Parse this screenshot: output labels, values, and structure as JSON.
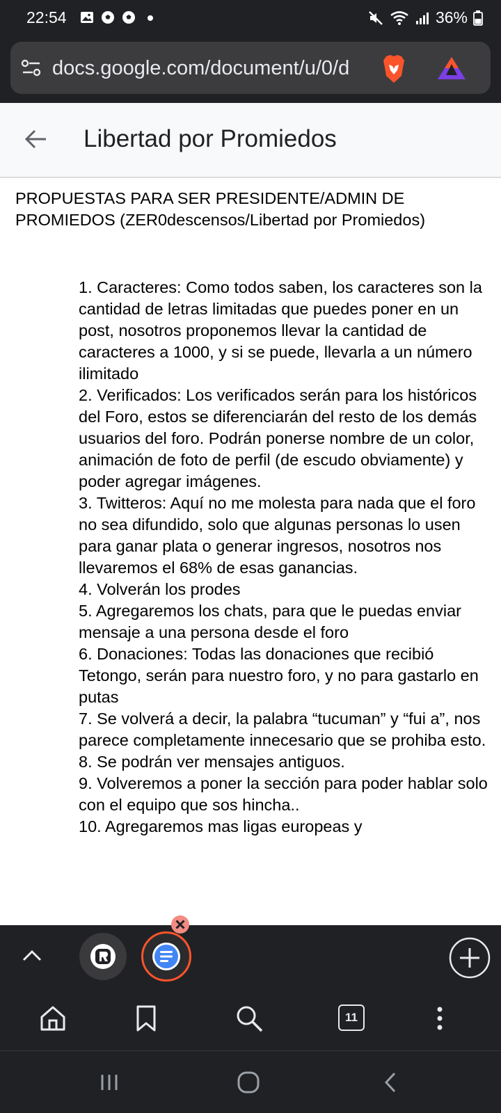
{
  "status_bar": {
    "time": "22:54",
    "battery": "36%",
    "left_icons": [
      "gallery-icon",
      "soccer-ball-icon",
      "soccer-ball-icon",
      "dot-icon"
    ],
    "right_icons": [
      "mute-icon",
      "wifi-icon",
      "signal-icon",
      "battery-icon"
    ]
  },
  "browser": {
    "url": "docs.google.com/document/u/0/d",
    "icons": [
      "site-settings-icon",
      "brave-shields-icon",
      "brave-rewards-icon"
    ],
    "colors": {
      "chrome": "#202124",
      "urlbar": "#3c3c3f",
      "brave": "#fb542b"
    }
  },
  "doc_header": {
    "title": "Libertad por Promiedos",
    "back_icon": "back-arrow-icon"
  },
  "document": {
    "heading": "PROPUESTAS PARA SER PRESIDENTE/ADMIN DE PROMIEDOS (ZER0descensos/Libertad por Promiedos)",
    "items": [
      "1. Caracteres: Como todos saben, los caracteres son la cantidad de letras limitadas que puedes poner en un post, nosotros proponemos llevar la cantidad de caracteres a 1000, y si se puede, llevarla a un número ilimitado",
      "2. Verificados: Los verificados serán para los históricos del Foro, estos se diferenciarán del resto de los demás usuarios del foro. Podrán ponerse nombre de un color, animación de foto de perfil (de escudo obviamente) y poder agregar imágenes.",
      "3. Twitteros: Aquí no me molesta para nada que el foro no sea difundido, solo que algunas personas lo usen para ganar plata o generar ingresos, nosotros nos llevaremos el 68% de esas ganancias.",
      "4. Volverán los prodes",
      "5. Agregaremos los chats, para que le puedas enviar mensaje a una persona desde el foro",
      "6. Donaciones: Todas las donaciones que recibió Tetongo, serán para nuestro foro, y no para gastarlo en putas",
      "7. Se volverá a decir, la palabra “tucuman” y “fui a”, nos parece completamente innecesario que se prohiba esto.",
      "8. Se podrán ver mensajes antiguos.",
      "9. Volveremos a poner la sección para poder hablar solo con el equipo que sos hincha..",
      "10. Agregaremos mas ligas europeas y"
    ]
  },
  "tab_bar": {
    "icons": [
      "chevron-up-icon",
      "tab-app-icon",
      "google-docs-tab-icon",
      "close-tab-icon",
      "new-tab-plus-icon"
    ]
  },
  "toolbar": {
    "tab_count": "11",
    "icons": [
      "home-icon",
      "bookmark-icon",
      "search-icon",
      "tab-count-icon",
      "more-vert-icon"
    ]
  },
  "nav_bar": {
    "icons": [
      "recents-icon",
      "home-button-icon",
      "back-nav-icon"
    ]
  }
}
